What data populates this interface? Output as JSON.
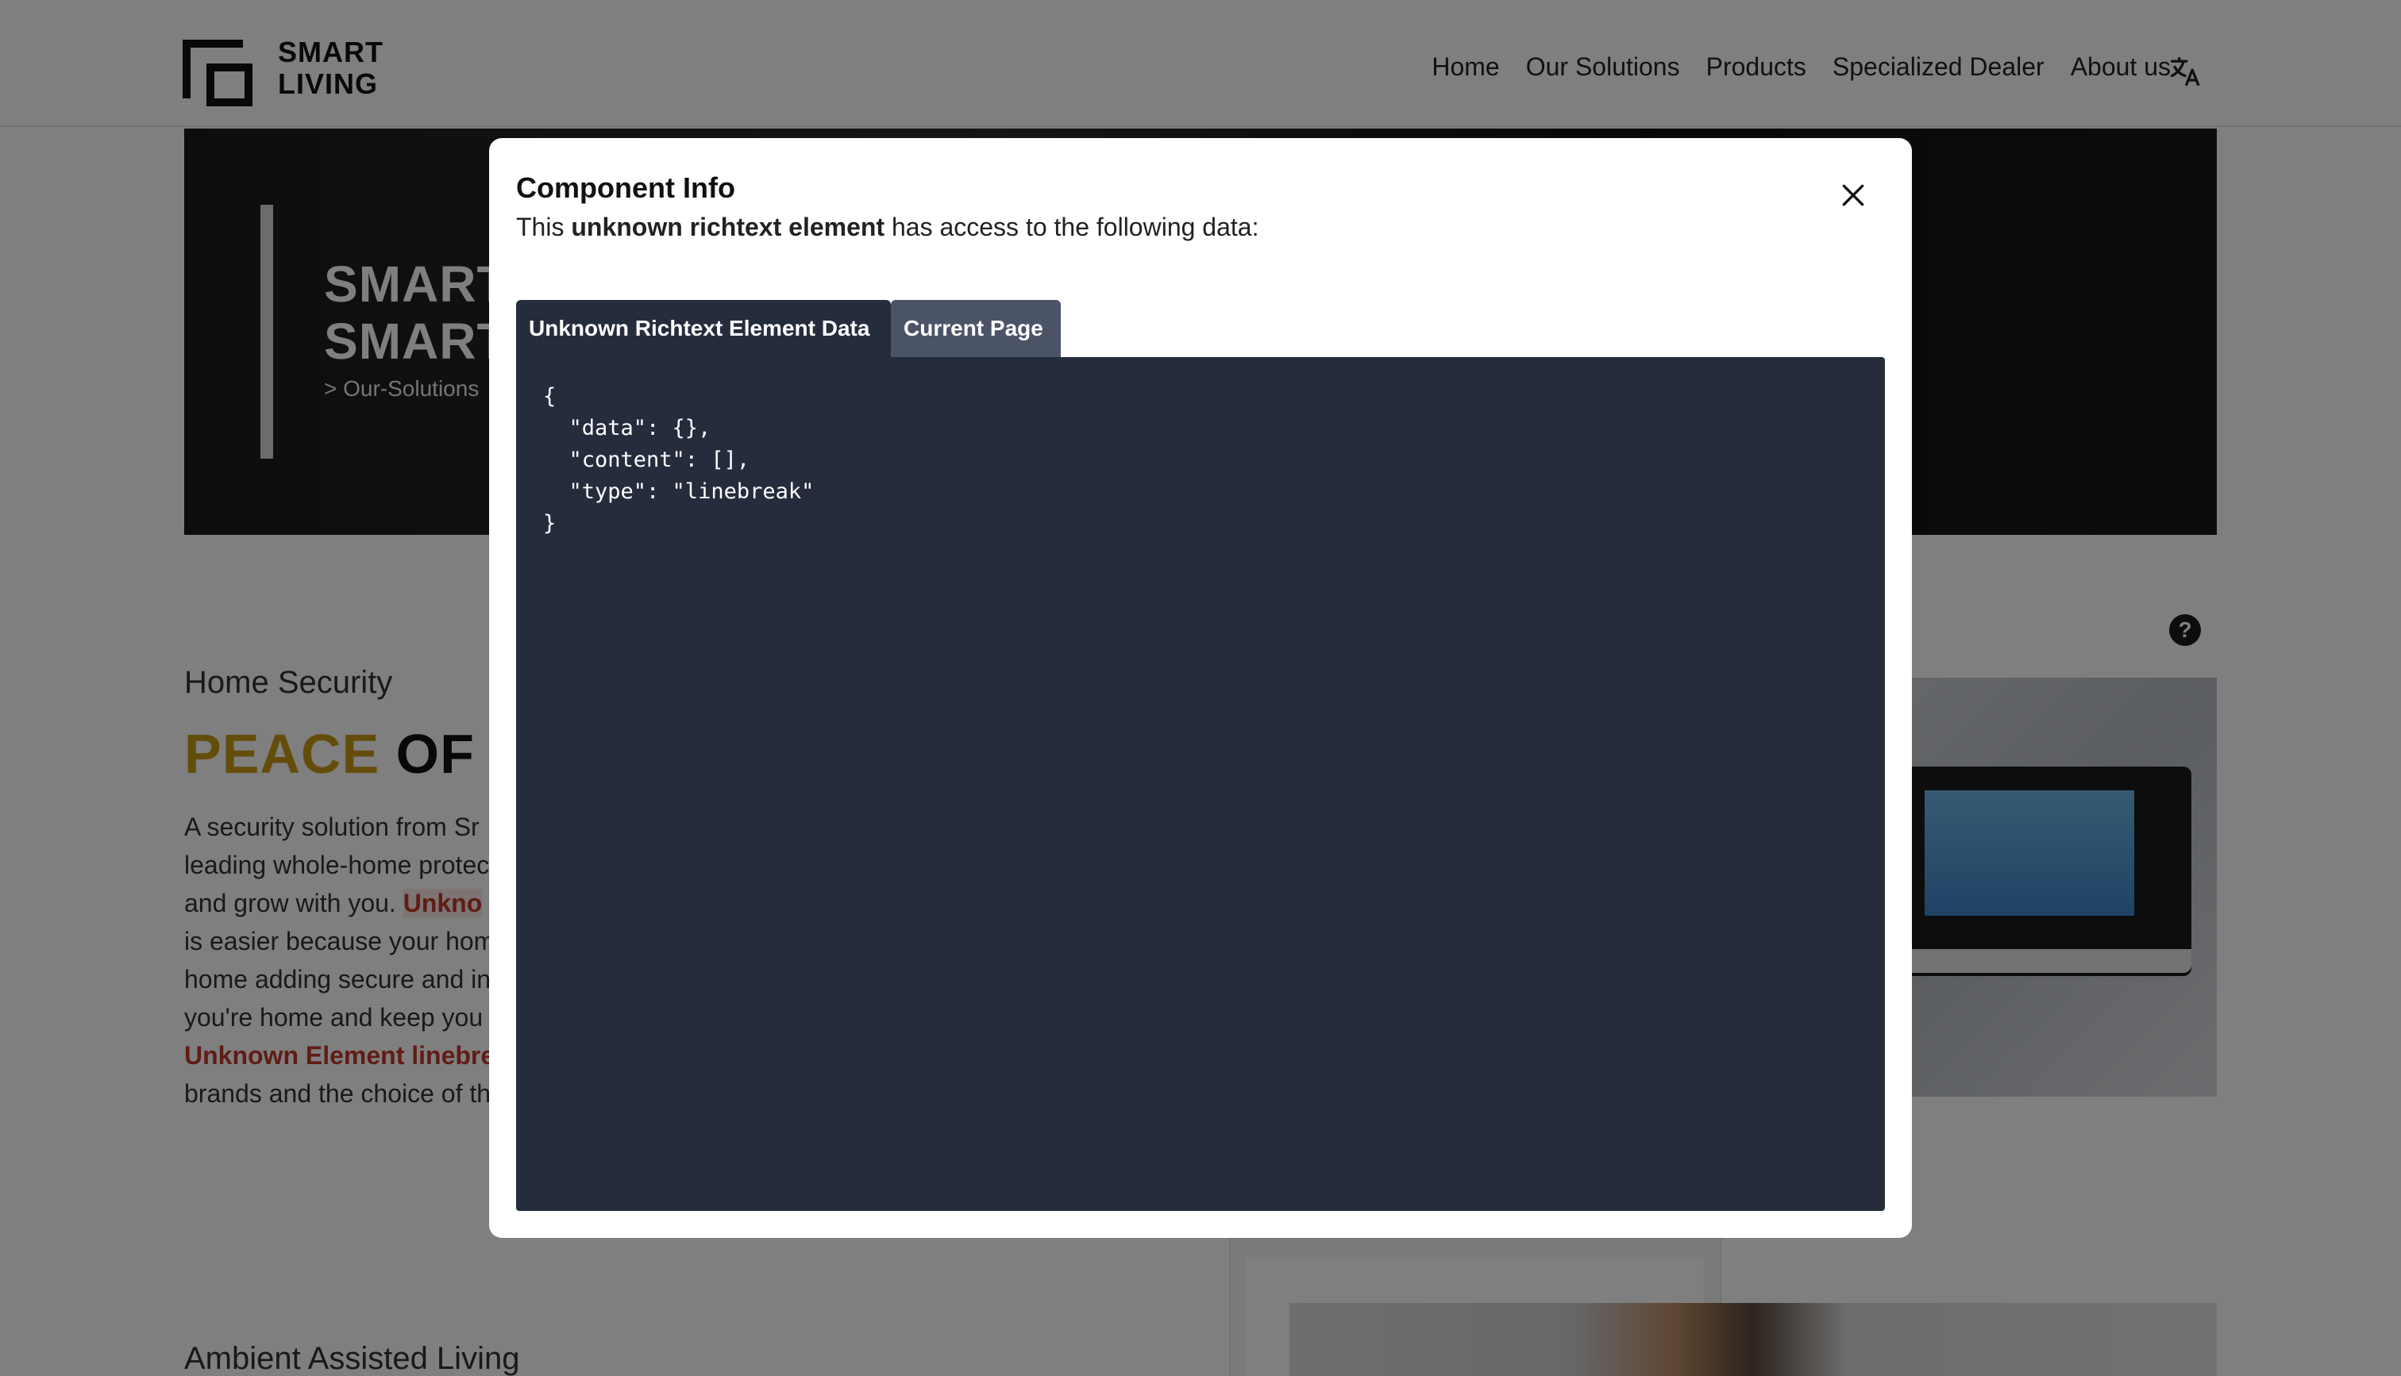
{
  "header": {
    "logo": {
      "line1": "SMART",
      "line2": "LIVING"
    },
    "nav": [
      "Home",
      "Our Solutions",
      "Products",
      "Specialized Dealer",
      "About us"
    ],
    "translate_icon": "translate-icon"
  },
  "hero": {
    "title_line1": "SMART",
    "title_line2": "SMART",
    "breadcrumb": "> Our-Solutions"
  },
  "section": {
    "label": "Home Security",
    "heading_gold": "PEACE",
    "heading_dark": "OF I",
    "body_lines": [
      "A security solution from Sr",
      "leading whole-home protec",
      "is easier because your hom",
      "home adding secure and in",
      "you're home and keep you",
      "brands and the choice of th"
    ],
    "line3_text": "and grow with you. ",
    "line3_error": "Unkno",
    "line7_error": "Unknown Element linebre"
  },
  "help_icon": "?",
  "aal_label": "Ambient Assisted Living",
  "modal": {
    "title": "Component Info",
    "desc_prefix": "This ",
    "desc_bold": "unknown richtext element",
    "desc_suffix": " has access to the following data:",
    "tabs": [
      "Unknown Richtext Element Data",
      "Current Page"
    ],
    "active_tab": 0,
    "code": "{\n  \"data\": {},\n  \"content\": [],\n  \"type\": \"linebreak\"\n}",
    "close_icon": "close-icon"
  },
  "colors": {
    "gold": "#c99a14",
    "code_bg": "#252d3c",
    "tab_inactive": "#4b5467",
    "error_red": "#c0392b"
  }
}
